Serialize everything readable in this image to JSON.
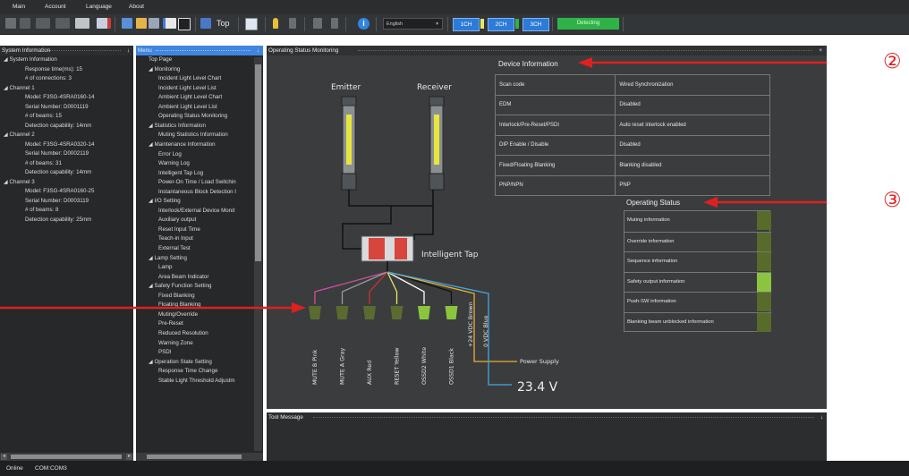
{
  "menubar": {
    "items": [
      "Main",
      "Account",
      "Language",
      "About"
    ]
  },
  "toolbar": {
    "top_label": "Top",
    "language_value": "English",
    "channels": [
      "1CH",
      "2CH",
      "3CH"
    ],
    "detecting_label": "Detecting"
  },
  "system_info": {
    "title": "System Information",
    "pin": "↓",
    "items": [
      {
        "text": "◢ System Information",
        "indent": 0
      },
      {
        "text": "Response time(ms): 15",
        "indent": 1
      },
      {
        "text": "# of connections: 3",
        "indent": 1
      },
      {
        "text": "◢ Channel 1",
        "indent": 0
      },
      {
        "text": "Model: F3SG-4SRA0160-14",
        "indent": 1
      },
      {
        "text": "Serial Number: D0001119",
        "indent": 1
      },
      {
        "text": "# of beams: 15",
        "indent": 1
      },
      {
        "text": "Detection capability: 14mm",
        "indent": 1
      },
      {
        "text": "◢ Channel 2",
        "indent": 0
      },
      {
        "text": "Model: F3SG-4SRA0320-14",
        "indent": 1
      },
      {
        "text": "Serial Number: D0002119",
        "indent": 1
      },
      {
        "text": "# of beams: 31",
        "indent": 1
      },
      {
        "text": "Detection capability: 14mm",
        "indent": 1
      },
      {
        "text": "◢ Channel 3",
        "indent": 0
      },
      {
        "text": "Model: F3SG-4SRA0160-25",
        "indent": 1
      },
      {
        "text": "Serial Number: D0003119",
        "indent": 1
      },
      {
        "text": "# of beams: 8",
        "indent": 1
      },
      {
        "text": "Detection capability: 25mm",
        "indent": 1
      }
    ]
  },
  "menu": {
    "title": "Menu",
    "pin": "↓",
    "items": [
      {
        "text": "Top Page",
        "indent": 0
      },
      {
        "text": "◢ Monitoring",
        "indent": 0
      },
      {
        "text": "Incident Light Level Chart",
        "indent": 1
      },
      {
        "text": "Incident Light Level List",
        "indent": 1
      },
      {
        "text": "Ambient Light Level Chart",
        "indent": 1
      },
      {
        "text": "Ambient Light Level List",
        "indent": 1
      },
      {
        "text": "Operating Status Monitoring",
        "indent": 1
      },
      {
        "text": "◢ Statistics Information",
        "indent": 0
      },
      {
        "text": "Muting Statistics Information",
        "indent": 1
      },
      {
        "text": "◢ Maintenance Information",
        "indent": 0
      },
      {
        "text": "Error Log",
        "indent": 1
      },
      {
        "text": "Warning Log",
        "indent": 1
      },
      {
        "text": "Intelligent Tap Log",
        "indent": 1
      },
      {
        "text": "Power-On Time / Load Switchin",
        "indent": 1
      },
      {
        "text": "Instantaneous Block Detection I",
        "indent": 1
      },
      {
        "text": "◢ I/O Setting",
        "indent": 0
      },
      {
        "text": "Interlock/External Device Monit",
        "indent": 1
      },
      {
        "text": "Auxiliary output",
        "indent": 1
      },
      {
        "text": "Reset Input Time",
        "indent": 1
      },
      {
        "text": "Teach-in Input",
        "indent": 1
      },
      {
        "text": "External Test",
        "indent": 1
      },
      {
        "text": "◢ Lamp Setting",
        "indent": 0
      },
      {
        "text": "Lamp",
        "indent": 1
      },
      {
        "text": "Area Beam Indicator",
        "indent": 1
      },
      {
        "text": "◢ Safety Function Setting",
        "indent": 0
      },
      {
        "text": "Fixed Blanking",
        "indent": 1
      },
      {
        "text": "Floating Blanking",
        "indent": 1
      },
      {
        "text": "Muting/Override",
        "indent": 1
      },
      {
        "text": "Pre-Reset",
        "indent": 1
      },
      {
        "text": "Reduced Resolution",
        "indent": 1
      },
      {
        "text": "Warning Zone",
        "indent": 1
      },
      {
        "text": "PSDI",
        "indent": 1
      },
      {
        "text": "◢ Operation State Setting",
        "indent": 0
      },
      {
        "text": "Response Time Change",
        "indent": 1
      },
      {
        "text": "Stable Light Threshold Adjustm",
        "indent": 1
      }
    ]
  },
  "monitor": {
    "title": "Operating Status Monitoring",
    "close": "×",
    "emitter_label": "Emitter",
    "receiver_label": "Receiver",
    "tap_label": "Intelligent Tap",
    "wires": [
      {
        "label": "MUTE B Pink",
        "color": "#d24f9e",
        "led": "#5b6b30"
      },
      {
        "label": "MUTE A Gray",
        "color": "#9a9a9a",
        "led": "#5b6b30"
      },
      {
        "label": "AUX Red",
        "color": "#d0322e",
        "led": "#5b6b30"
      },
      {
        "label": "RESET Yellow",
        "color": "#e7e76a",
        "led": "#5b6b30"
      },
      {
        "label": "OSSD2 White",
        "color": "#ffffff",
        "led": "#8bc43f"
      },
      {
        "label": "OSSD1 Black",
        "color": "#111111",
        "led": "#8bc43f"
      }
    ],
    "supply_wires": [
      {
        "label": "+24 VDC Brown",
        "color": "#e8b030"
      },
      {
        "label": "0 VDC Blue",
        "color": "#45a8e0"
      }
    ],
    "power_supply_label": "Power Supply",
    "voltage": "23.4 V"
  },
  "device_info": {
    "title": "Device Information",
    "rows": [
      [
        "Scan code",
        "Wired Synchronization"
      ],
      [
        "EDM",
        "Disabled"
      ],
      [
        "Interlock/Pre-Reset/PSDI",
        "Auto reset interlock enabled"
      ],
      [
        "DIP Enable / Disable",
        "Disabled"
      ],
      [
        "Fixed/Floating Blanking",
        "Blanking disabled"
      ],
      [
        "PNP/NPN",
        "PNP"
      ]
    ]
  },
  "operating_status": {
    "title": "Operating Status",
    "rows": [
      {
        "label": "Muting information",
        "on": false
      },
      {
        "label": "Override information",
        "on": false
      },
      {
        "label": "Sequence information",
        "on": false
      },
      {
        "label": "Safety output information",
        "on": true
      },
      {
        "label": "Push-SW information",
        "on": false
      },
      {
        "label": "Blanking beam unblocked information",
        "on": false
      }
    ]
  },
  "tool_message": {
    "title": "Tool Message",
    "pin": "↓"
  },
  "statusbar": {
    "status": "Online",
    "port": "COM:COM3"
  },
  "callouts": {
    "two": "②",
    "three": "③"
  },
  "colors": {
    "accent": "#2d7bd8",
    "detecting": "#2fb348",
    "led_on": "#8bc43f",
    "led_off": "#586b2a",
    "callout": "#e02020"
  }
}
